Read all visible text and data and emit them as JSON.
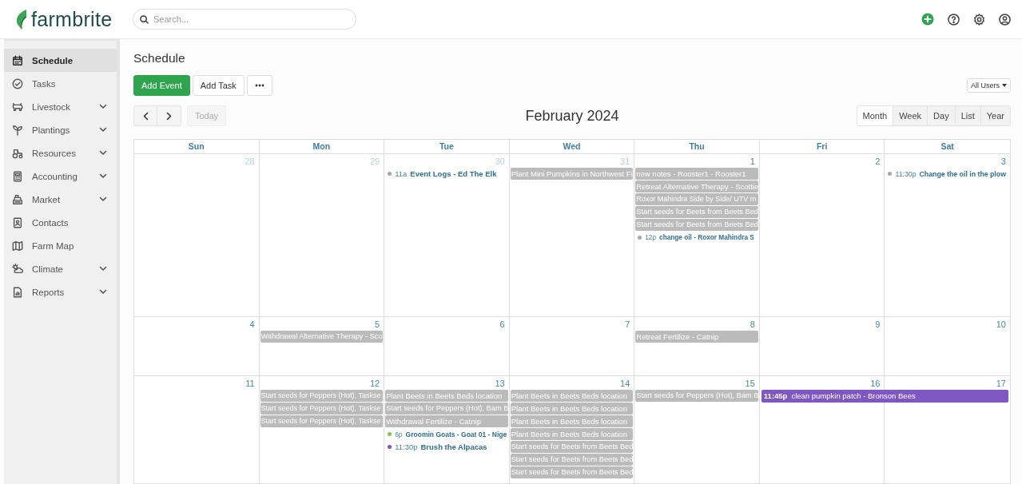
{
  "app": {
    "logo": "farmbrite"
  },
  "search": {
    "placeholder": "Search..."
  },
  "sidebar": {
    "items": [
      {
        "label": "Schedule",
        "selected": true,
        "expandable": false
      },
      {
        "label": "Tasks",
        "selected": false,
        "expandable": false
      },
      {
        "label": "Livestock",
        "selected": false,
        "expandable": true
      },
      {
        "label": "Plantings",
        "selected": false,
        "expandable": true
      },
      {
        "label": "Resources",
        "selected": false,
        "expandable": true
      },
      {
        "label": "Accounting",
        "selected": false,
        "expandable": true
      },
      {
        "label": "Market",
        "selected": false,
        "expandable": true
      },
      {
        "label": "Contacts",
        "selected": false,
        "expandable": false
      },
      {
        "label": "Farm Map",
        "selected": false,
        "expandable": false
      },
      {
        "label": "Climate",
        "selected": false,
        "expandable": true
      },
      {
        "label": "Reports",
        "selected": false,
        "expandable": true
      }
    ]
  },
  "page": {
    "title": "Schedule"
  },
  "toolbar": {
    "buttons": [
      {
        "label": "Add Event",
        "kind": "primary"
      },
      {
        "label": "Add Task",
        "kind": "default"
      }
    ],
    "user_filter": "All Users"
  },
  "calendar": {
    "title": "February 2024",
    "today_button": {
      "label": "Today",
      "disabled": true
    },
    "views": [
      {
        "label": "Month",
        "selected": true
      },
      {
        "label": "Week",
        "selected": false
      },
      {
        "label": "Day",
        "selected": false
      },
      {
        "label": "List",
        "selected": false
      },
      {
        "label": "Year",
        "selected": false
      }
    ],
    "weekdays": [
      "Sun",
      "Mon",
      "Tue",
      "Wed",
      "Thu",
      "Fri",
      "Sat"
    ],
    "weeks": [
      {
        "days": [
          {
            "number": "28",
            "other_month": true
          },
          {
            "number": "29",
            "other_month": true
          },
          {
            "number": "30",
            "other_month": true,
            "events": [
              {
                "kind": "dot",
                "color": "#a8a8a8",
                "time": "11a",
                "title": "Event Logs - Ed The Elk"
              }
            ]
          },
          {
            "number": "31",
            "other_month": true,
            "events": [
              {
                "kind": "bar",
                "title": "Plant Mini Pumpkins in Northwest Fi"
              }
            ]
          },
          {
            "number": "1",
            "other_month": false,
            "events": [
              {
                "kind": "bar",
                "title": "new notes - Rooster1 - Rooster1"
              },
              {
                "kind": "bar",
                "title": "Retreat Alternative Therapy - Scottie"
              },
              {
                "kind": "bar",
                "title": "Roxor Mahindra Side by Side/ UTV m"
              },
              {
                "kind": "bar",
                "title": "Start seeds for Beets from Beets Bed"
              },
              {
                "kind": "bar",
                "title": "Start seeds for Beets from Beets Bed"
              },
              {
                "kind": "dot",
                "color": "#a8a8a8",
                "time": "12p",
                "title": "change oil - Roxor Mahindra S"
              }
            ]
          },
          {
            "number": "2",
            "other_month": false
          },
          {
            "number": "3",
            "other_month": false,
            "events": [
              {
                "kind": "dot",
                "color": "#a8a8a8",
                "time": "11:30p",
                "title": "Change the oil in the plow"
              }
            ]
          }
        ]
      },
      {
        "days": [
          {
            "number": "4",
            "other_month": false
          },
          {
            "number": "5",
            "other_month": false,
            "events": [
              {
                "kind": "bar",
                "title": "Withdrawal Alternative Therapy - Sco"
              }
            ]
          },
          {
            "number": "6",
            "other_month": false
          },
          {
            "number": "7",
            "other_month": false
          },
          {
            "number": "8",
            "other_month": false,
            "events": [
              {
                "kind": "bar",
                "title": "Retreat Fertilize - Catnip"
              }
            ]
          },
          {
            "number": "9",
            "other_month": false
          },
          {
            "number": "10",
            "other_month": false
          }
        ]
      },
      {
        "days": [
          {
            "number": "11",
            "other_month": false
          },
          {
            "number": "12",
            "other_month": false,
            "events": [
              {
                "kind": "bar",
                "title": "Start seeds for Peppers (Hot), Taskse"
              },
              {
                "kind": "bar",
                "title": "Start seeds for Peppers (Hot), Taskse"
              },
              {
                "kind": "bar",
                "title": "Start seeds for Peppers (Hot), Taskse"
              }
            ]
          },
          {
            "number": "13",
            "other_month": false,
            "events": [
              {
                "kind": "bar",
                "title": "Plant Beets in Beets Beds location"
              },
              {
                "kind": "bar",
                "title": "Start seeds for Peppers (Hot), Bam B"
              },
              {
                "kind": "bar",
                "title": "Withdrawal Fertilize - Catnip"
              },
              {
                "kind": "dot",
                "color": "#8bc34a",
                "time": "6p",
                "title": "Groomin Goats - Goat 01 - Nige"
              },
              {
                "kind": "dot",
                "color": "#7e57c2",
                "time": "11:30p",
                "title": "Brush the Alpacas"
              }
            ]
          },
          {
            "number": "14",
            "other_month": false,
            "events": [
              {
                "kind": "bar",
                "title": "Plant Beets in Beets Beds location"
              },
              {
                "kind": "bar",
                "title": "Plant Beets in Beets Beds location"
              },
              {
                "kind": "bar",
                "title": "Plant Beets in Beets Beds location"
              },
              {
                "kind": "bar",
                "title": "Plant Beets in Beets Beds location"
              },
              {
                "kind": "bar",
                "title": "Start seeds for Beets from Beets Bed"
              },
              {
                "kind": "bar",
                "title": "Start seeds for Beets from Beets Bed"
              },
              {
                "kind": "bar",
                "title": "Start seeds for Beets from Beets Bed"
              }
            ]
          },
          {
            "number": "15",
            "other_month": false,
            "events": [
              {
                "kind": "bar",
                "title": "Start seeds for Peppers (Hot), Bam B"
              }
            ]
          },
          {
            "number": "16",
            "other_month": false,
            "events": [
              {
                "kind": "two-day",
                "color": "#7e57c2",
                "time": "11:45p",
                "title": "clean pumpkin patch - Bronson Bees"
              }
            ]
          },
          {
            "number": "17",
            "other_month": false
          }
        ]
      }
    ]
  }
}
